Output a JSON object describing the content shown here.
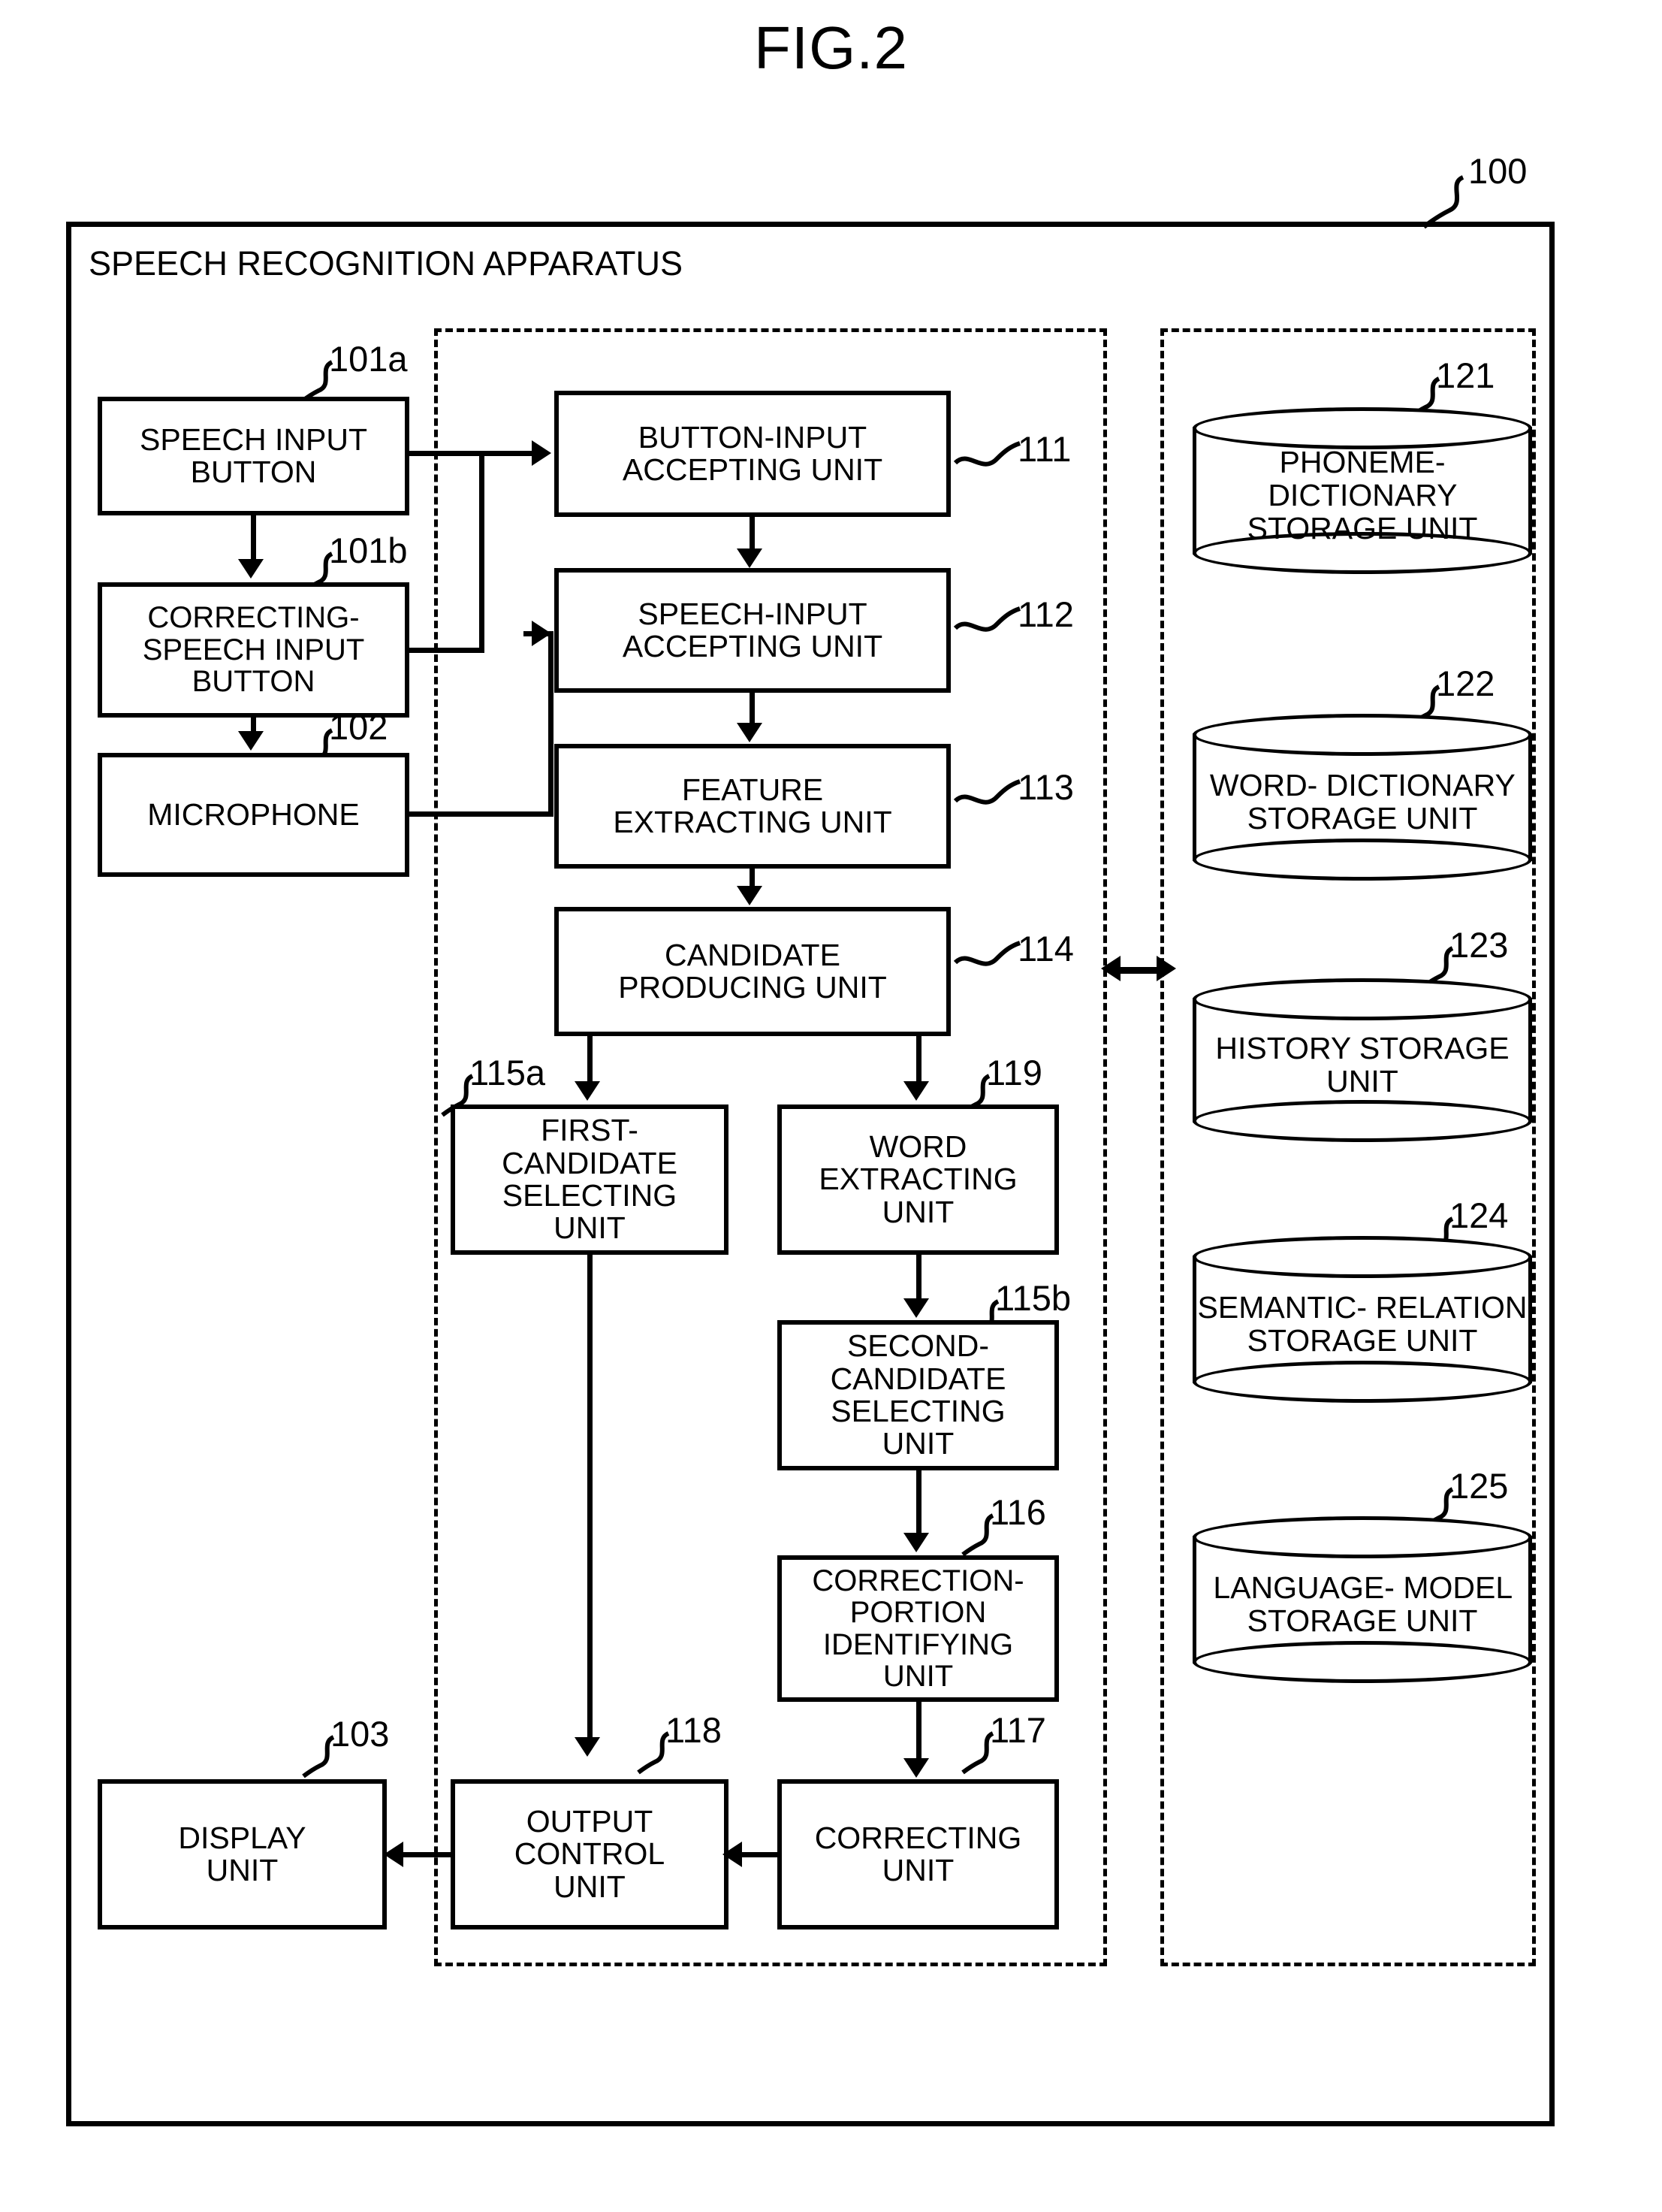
{
  "figure": {
    "title": "FIG.2",
    "apparatus_label": "SPEECH RECOGNITION APPARATUS",
    "apparatus_ref": "100"
  },
  "input_blocks": [
    {
      "ref": "101a",
      "label_lines": [
        "SPEECH INPUT",
        "BUTTON"
      ]
    },
    {
      "ref": "101b",
      "label_lines": [
        "CORRECTING-",
        "SPEECH INPUT",
        "BUTTON"
      ]
    },
    {
      "ref": "102",
      "label_lines": [
        "MICROPHONE"
      ]
    }
  ],
  "output_blocks": [
    {
      "ref": "103",
      "label_lines": [
        "DISPLAY",
        "UNIT"
      ]
    }
  ],
  "processing_blocks": [
    {
      "ref": "111",
      "label_lines": [
        "BUTTON-INPUT",
        "ACCEPTING UNIT"
      ]
    },
    {
      "ref": "112",
      "label_lines": [
        "SPEECH-INPUT",
        "ACCEPTING UNIT"
      ]
    },
    {
      "ref": "113",
      "label_lines": [
        "FEATURE",
        "EXTRACTING UNIT"
      ]
    },
    {
      "ref": "114",
      "label_lines": [
        "CANDIDATE",
        "PRODUCING UNIT"
      ]
    },
    {
      "ref": "115a",
      "label_lines": [
        "FIRST-",
        "CANDIDATE",
        "SELECTING",
        "UNIT"
      ]
    },
    {
      "ref": "119",
      "label_lines": [
        "WORD",
        "EXTRACTING",
        "UNIT"
      ]
    },
    {
      "ref": "115b",
      "label_lines": [
        "SECOND-",
        "CANDIDATE",
        "SELECTING",
        "UNIT"
      ]
    },
    {
      "ref": "116",
      "label_lines": [
        "CORRECTION-",
        "PORTION",
        "IDENTIFYING",
        "UNIT"
      ]
    },
    {
      "ref": "117",
      "label_lines": [
        "CORRECTING",
        "UNIT"
      ]
    },
    {
      "ref": "118",
      "label_lines": [
        "OUTPUT",
        "CONTROL",
        "UNIT"
      ]
    }
  ],
  "storage_blocks": [
    {
      "ref": "121",
      "label_lines": [
        "PHONEME-",
        "DICTIONARY",
        "STORAGE UNIT"
      ]
    },
    {
      "ref": "122",
      "label_lines": [
        "WORD-",
        "DICTIONARY",
        "STORAGE UNIT"
      ]
    },
    {
      "ref": "123",
      "label_lines": [
        "HISTORY",
        "STORAGE UNIT"
      ]
    },
    {
      "ref": "124",
      "label_lines": [
        "SEMANTIC-",
        "RELATION",
        "STORAGE UNIT"
      ]
    },
    {
      "ref": "125",
      "label_lines": [
        "LANGUAGE-",
        "MODEL",
        "STORAGE UNIT"
      ]
    }
  ],
  "colors": {
    "ink": "#000000",
    "paper": "#ffffff"
  }
}
